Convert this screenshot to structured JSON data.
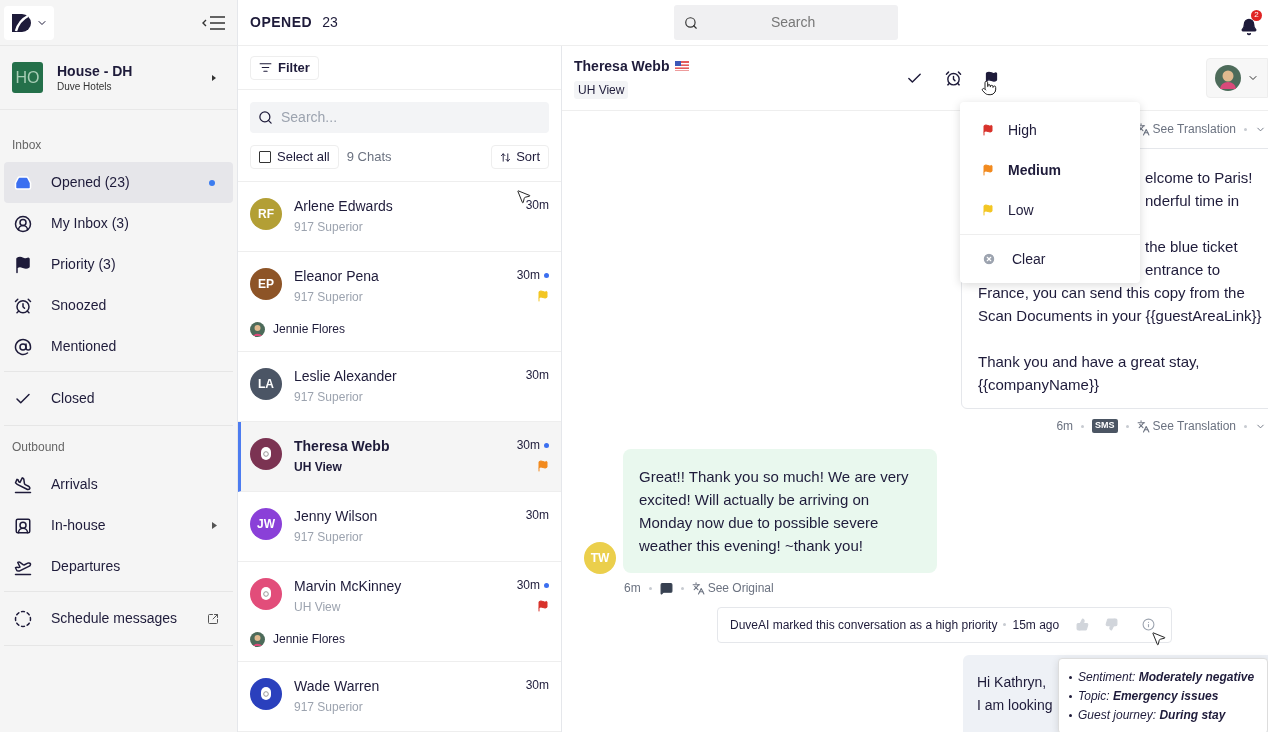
{
  "top_bar": {
    "title": "OPENED",
    "count": "23",
    "search_placeholder": "Search",
    "notifications": "2"
  },
  "sidebar": {
    "property": {
      "initials": "HO",
      "name": "House - DH",
      "company": "Duve Hotels"
    },
    "groups": [
      {
        "title": "Inbox",
        "items": [
          {
            "kind": "inbox",
            "label": "Opened (23)",
            "selected": true,
            "unread": true
          },
          {
            "kind": "user",
            "label": "My Inbox (3)",
            "selected": false,
            "unread": false
          },
          {
            "kind": "flag",
            "label": "Priority (3)",
            "selected": false,
            "unread": false
          },
          {
            "kind": "snooze",
            "label": "Snoozed",
            "selected": false,
            "unread": false
          },
          {
            "kind": "mention",
            "label": "Mentioned",
            "selected": false,
            "unread": false
          }
        ]
      },
      {
        "items": [
          {
            "kind": "check",
            "label": "Closed",
            "selected": false,
            "unread": false
          }
        ]
      },
      {
        "title": "Outbound",
        "items": [
          {
            "kind": "arrivals",
            "label": "Arrivals",
            "selected": false,
            "unread": false
          },
          {
            "kind": "inhouse",
            "label": "In-house",
            "selected": false,
            "unread": false,
            "submenu": true
          },
          {
            "kind": "departures",
            "label": "Departures",
            "selected": false,
            "unread": false
          }
        ]
      },
      {
        "items": [
          {
            "kind": "schedule",
            "label": "Schedule messages",
            "selected": false,
            "unread": false,
            "external": true
          }
        ]
      }
    ]
  },
  "chat_list": {
    "filter": "Filter",
    "search_placeholder": "Search...",
    "select_all": {
      "label": "Select all",
      "checked": false
    },
    "count": "9 Chats",
    "sort": "Sort",
    "chats": [
      {
        "kind": "initials",
        "initials": "RF",
        "color": "#b39f35",
        "name": "Arlene Edwards",
        "subtitle": "917 Superior",
        "time": "30m",
        "unread": false,
        "selected": false
      },
      {
        "kind": "initials",
        "initials": "EP",
        "color": "#8d5427",
        "name": "Eleanor Pena",
        "subtitle": "917 Superior",
        "time": "30m",
        "unread": true,
        "flag": {
          "color": "#f3c623"
        },
        "assignee": "Jennie Flores",
        "selected": false
      },
      {
        "kind": "initials",
        "initials": "LA",
        "color": "#4b5565",
        "name": "Leslie Alexander",
        "subtitle": "917 Superior",
        "time": "30m",
        "unread": false,
        "selected": false
      },
      {
        "kind": "guest",
        "color": "#7b3352",
        "name": "Theresa Webb",
        "subtitle": "UH View",
        "time": "30m",
        "unread": true,
        "flag": {
          "color": "#f28a1e"
        },
        "selected": true
      },
      {
        "kind": "initials",
        "initials": "JW",
        "color": "#8a40d8",
        "name": "Jenny Wilson",
        "subtitle": "917 Superior",
        "time": "30m",
        "unread": false,
        "selected": false
      },
      {
        "kind": "guest",
        "color": "#e24d7a",
        "name": "Marvin McKinney",
        "subtitle": "UH View",
        "time": "30m",
        "unread": true,
        "flag": {
          "color": "#d8322b"
        },
        "assignee": "Jennie Flores",
        "selected": false
      },
      {
        "kind": "guest",
        "color": "#2a40bd",
        "name": "Wade Warren",
        "subtitle": "917 Superior",
        "time": "30m",
        "unread": false,
        "selected": false
      }
    ]
  },
  "conversation": {
    "name": "Theresa Webb",
    "tag": "UH View",
    "priority_menu": {
      "options": [
        {
          "color": "#d8322b",
          "label": "High",
          "selected": false
        },
        {
          "color": "#f28a1e",
          "label": "Medium",
          "selected": true
        },
        {
          "color": "#f3c623",
          "label": "Low",
          "selected": false
        }
      ],
      "clear": "Clear"
    },
    "messages": [
      {
        "kind": "outgoing",
        "meta_top": {
          "translation": "See Translation"
        },
        "paragraphs": [
          [
            {
              "text": "elcome to Paris!",
              "partial": true
            },
            {
              "text": "nderful time in",
              "partial": true
            }
          ],
          [
            {
              "text": "the blue ticket",
              "partial": true
            },
            {
              "text": "entrance to",
              "partial": true
            },
            {
              "text": "France, you can send this copy from the"
            },
            {
              "text": "Scan Documents in your {{guestAreaLink}}"
            }
          ],
          [
            {
              "text": "Thank you and have a great stay,"
            },
            {
              "text": "{{companyName}}"
            }
          ]
        ],
        "meta": {
          "time": "6m",
          "channel": "SMS",
          "translation": "See Translation"
        }
      },
      {
        "kind": "incoming",
        "initials": "TW",
        "color": "#ebcf4c",
        "text": "Great!! Thank you so much! We are very excited! Will actually be arriving on Monday now due to possible severe weather this evening! ~thank you!",
        "meta": {
          "time": "6m",
          "translation": "See Original"
        }
      },
      {
        "kind": "system",
        "text": "DuveAI marked this conversation as a high priority",
        "time": "15m ago"
      },
      {
        "kind": "outgoing_short",
        "lines": [
          "Hi Kathryn,",
          "I am looking"
        ]
      }
    ],
    "tooltip": [
      {
        "label": "Sentiment:",
        "value": "Moderately negative"
      },
      {
        "label": "Topic:",
        "value": "Emergency issues"
      },
      {
        "label": "Guest journey:",
        "value": "During stay"
      }
    ]
  }
}
